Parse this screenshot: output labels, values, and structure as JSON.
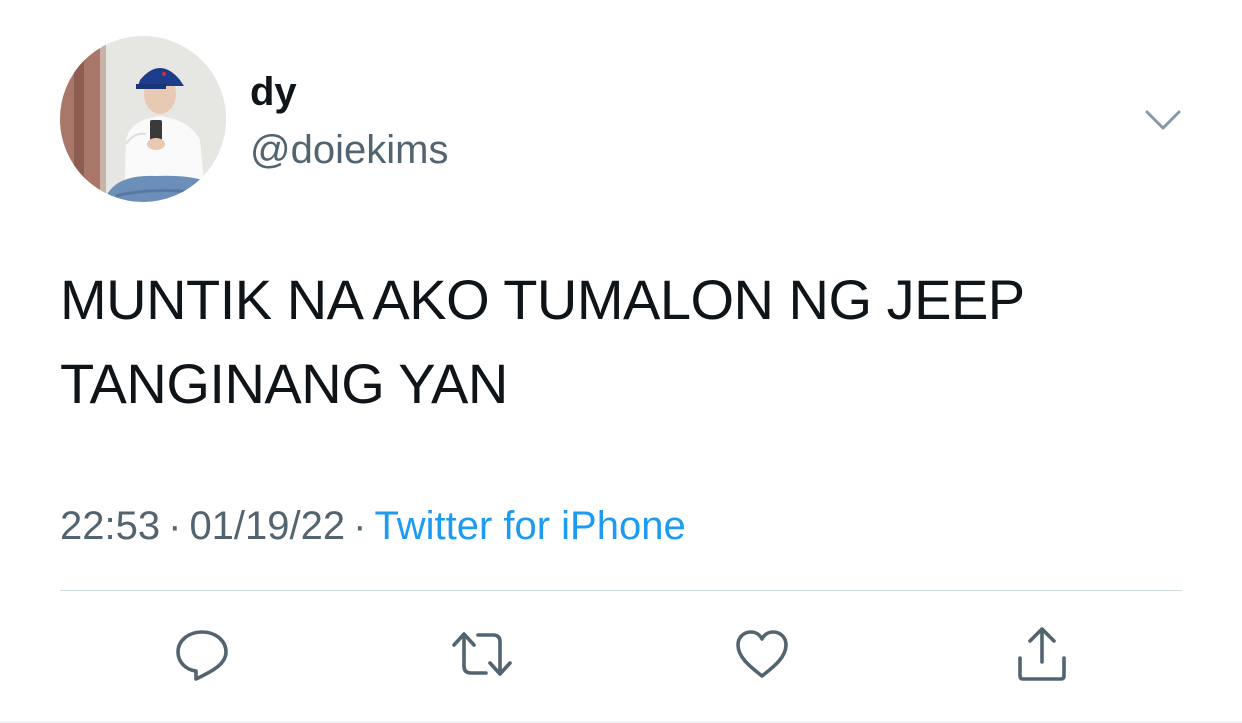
{
  "user": {
    "display_name": "dy",
    "handle": "@doiekims",
    "avatar": "profile-photo-avatar"
  },
  "tweet": {
    "lines": [
      "MUNTIK NA AKO TUMALON NG JEEP",
      "TANGINANG YAN"
    ],
    "time": "22:53",
    "date": "01/19/22",
    "separator": "·",
    "source": "Twitter for iPhone"
  },
  "icons": {
    "more": "chevron-down-icon",
    "reply": "reply-icon",
    "retweet": "retweet-icon",
    "like": "heart-icon",
    "share": "share-icon"
  },
  "colors": {
    "text": "#0f1419",
    "secondary": "#536471",
    "link": "#1d9bf0",
    "divider": "#cfd9de"
  }
}
